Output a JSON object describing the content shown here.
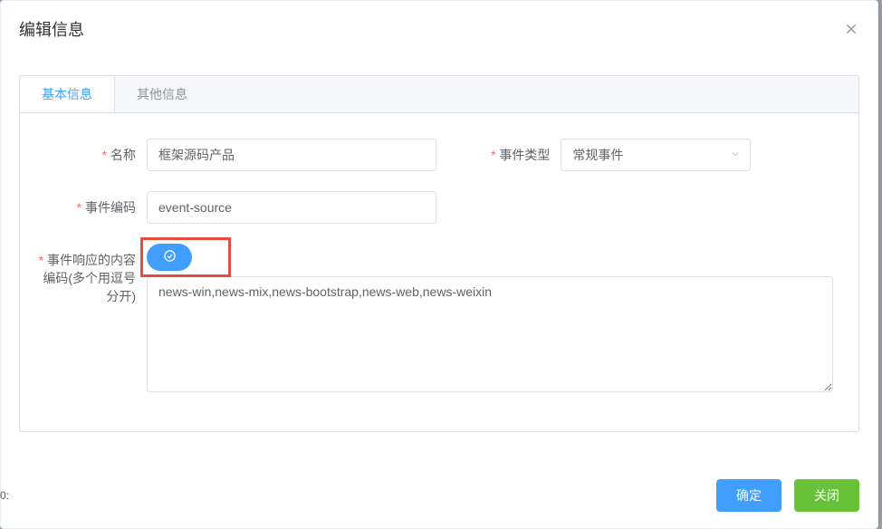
{
  "dialog": {
    "title": "编辑信息"
  },
  "tabs": [
    {
      "label": "基本信息"
    },
    {
      "label": "其他信息"
    }
  ],
  "form": {
    "name": {
      "label": "名称",
      "value": "框架源码产品"
    },
    "eventType": {
      "label": "事件类型",
      "value": "常规事件"
    },
    "eventCode": {
      "label": "事件编码",
      "value": "event-source"
    },
    "responseContent": {
      "label": "事件响应的内容编码(多个用逗号分开)",
      "value": "news-win,news-mix,news-bootstrap,news-web,news-weixin"
    }
  },
  "footer": {
    "ok": "确定",
    "close": "关闭"
  },
  "bgLabel": "0:"
}
